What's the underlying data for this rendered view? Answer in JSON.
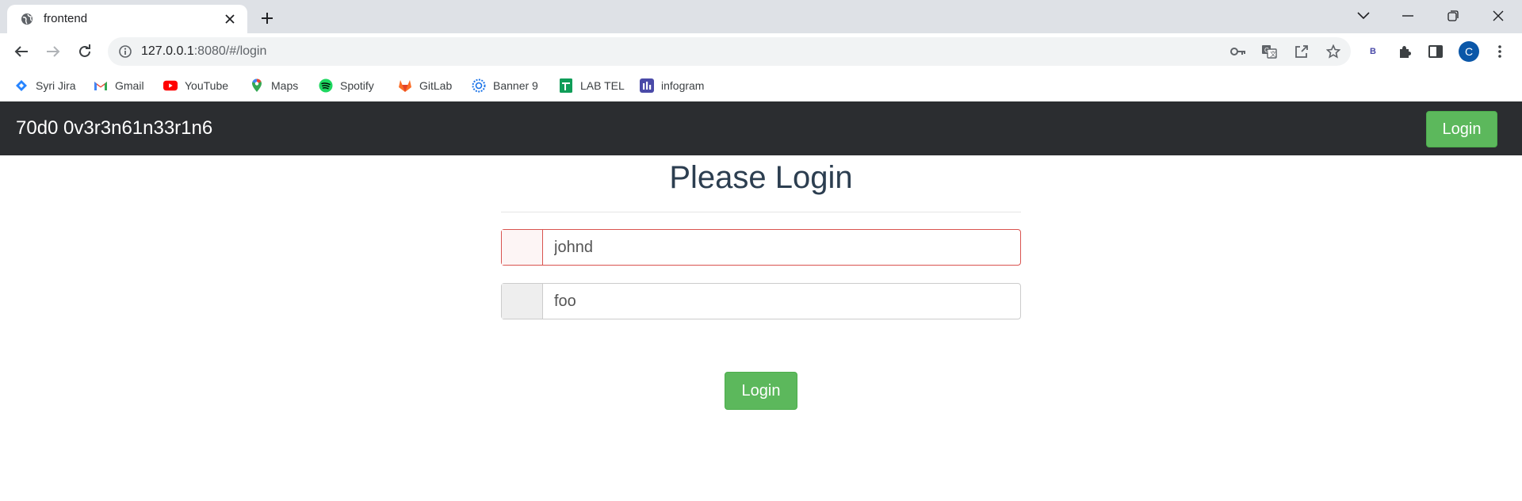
{
  "browser": {
    "tab": {
      "title": "frontend"
    },
    "address": {
      "host": "127.0.0.1",
      "rest": ":8080/#/login"
    },
    "extension_badge": "B",
    "profile_initial": "C",
    "bookmarks": [
      {
        "label": "Syri Jira",
        "icon": "jira-icon",
        "color": "#2684ff"
      },
      {
        "label": "Gmail",
        "icon": "gmail-icon",
        "color": "#ea4335"
      },
      {
        "label": "YouTube",
        "icon": "youtube-icon",
        "color": "#ff0000"
      },
      {
        "label": "Maps",
        "icon": "maps-icon",
        "color": "#34a853"
      },
      {
        "label": "Spotify",
        "icon": "spotify-icon",
        "color": "#1ed760"
      },
      {
        "label": "GitLab",
        "icon": "gitlab-icon",
        "color": "#fc6d26"
      },
      {
        "label": "Banner 9",
        "icon": "banner-icon",
        "color": "#1a73e8"
      },
      {
        "label": "LAB TEL",
        "icon": "sheets-icon",
        "color": "#0f9d58"
      },
      {
        "label": "infogram",
        "icon": "infogram-icon",
        "color": "#4a4aa8"
      }
    ]
  },
  "app": {
    "brand": "70d0 0v3r3n61n33r1n6",
    "nav_login_label": "Login",
    "accent_color": "#5cb85c",
    "navbar_color": "#2b2d30"
  },
  "login": {
    "title": "Please Login",
    "username_value": "johnd",
    "password_value": "foo",
    "submit_label": "Login",
    "error_color": "#d9534f"
  }
}
